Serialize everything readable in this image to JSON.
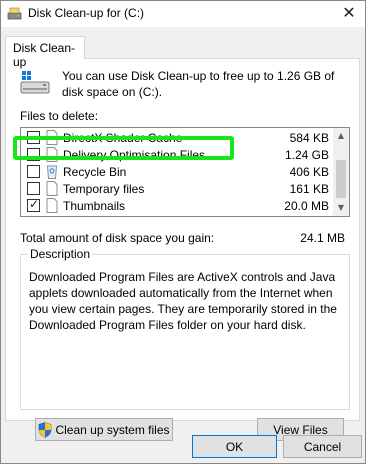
{
  "window": {
    "title": "Disk Clean-up for  (C:)",
    "close_glyph": "✕"
  },
  "tabs": [
    {
      "label": "Disk Clean-up"
    }
  ],
  "intro": {
    "text": "You can use Disk Clean-up to free up to 1.26 GB of disk space on  (C:).",
    "icon": "drive-icon"
  },
  "files_label": "Files to delete:",
  "files": [
    {
      "name": "DirectX Shader Cache",
      "size": "584 KB",
      "checked": false,
      "icon": "file-icon"
    },
    {
      "name": "Delivery Optimisation Files",
      "size": "1.24 GB",
      "checked": false,
      "icon": "file-icon"
    },
    {
      "name": "Recycle Bin",
      "size": "406 KB",
      "checked": false,
      "icon": "recycle-bin-icon"
    },
    {
      "name": "Temporary files",
      "size": "161 KB",
      "checked": false,
      "icon": "file-icon"
    },
    {
      "name": "Thumbnails",
      "size": "20.0 MB",
      "checked": true,
      "icon": "file-icon"
    }
  ],
  "check_glyph": "✓",
  "total": {
    "label": "Total amount of disk space you gain:",
    "value": "24.1 MB"
  },
  "description": {
    "legend": "Description",
    "text": "Downloaded Program Files are ActiveX controls and Java applets downloaded automatically from the Internet when you view certain pages. They are temporarily stored in the Downloaded Program Files folder on your hard disk."
  },
  "buttons": {
    "cleanup_system": "Clean up system files",
    "view_files": "View Files",
    "ok": "OK",
    "cancel": "Cancel"
  },
  "colors": {
    "highlight": "#19e619",
    "ok_border": "#0078d7"
  }
}
